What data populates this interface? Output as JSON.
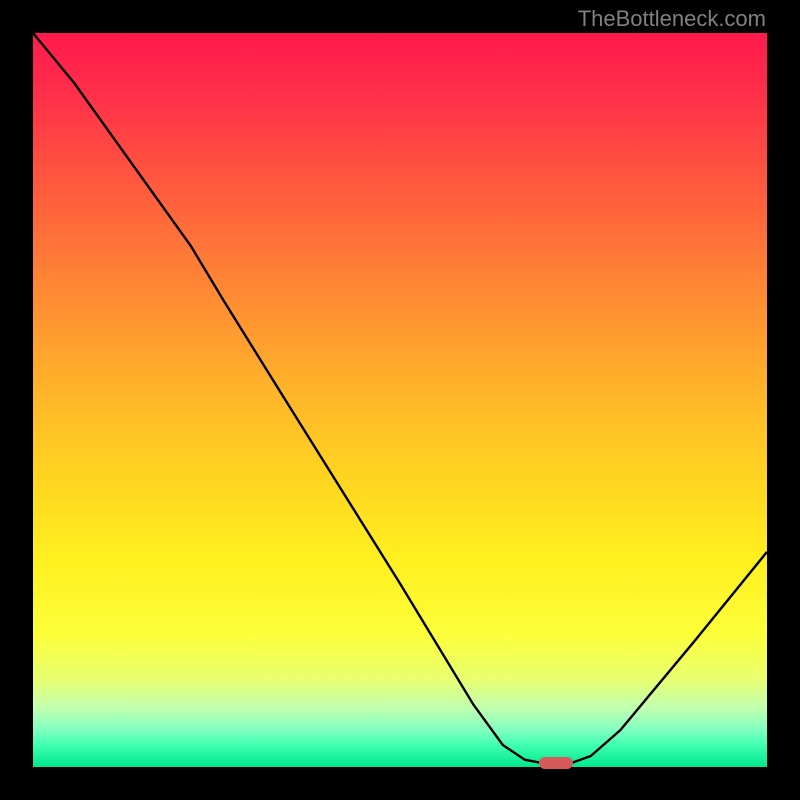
{
  "watermark": "TheBottleneck.com",
  "chart_data": {
    "type": "line",
    "title": "",
    "xlabel": "",
    "ylabel": "",
    "xlim": [
      0,
      100
    ],
    "ylim": [
      0,
      100
    ],
    "curve": {
      "points": [
        {
          "x": 0.0,
          "y": 100.0
        },
        {
          "x": 5.6,
          "y": 93.2
        },
        {
          "x": 21.5,
          "y": 71.0
        },
        {
          "x": 26.0,
          "y": 63.5
        },
        {
          "x": 35.0,
          "y": 49.0
        },
        {
          "x": 50.0,
          "y": 25.0
        },
        {
          "x": 60.0,
          "y": 8.5
        },
        {
          "x": 64.0,
          "y": 3.0
        },
        {
          "x": 67.0,
          "y": 1.0
        },
        {
          "x": 69.0,
          "y": 0.6
        },
        {
          "x": 73.5,
          "y": 0.6
        },
        {
          "x": 76.0,
          "y": 1.5
        },
        {
          "x": 80.0,
          "y": 5.0
        },
        {
          "x": 90.0,
          "y": 17.0
        },
        {
          "x": 100.0,
          "y": 29.3
        }
      ]
    },
    "marker": {
      "x": 71.3,
      "y": 0.6
    },
    "grid": false,
    "legend": false
  }
}
